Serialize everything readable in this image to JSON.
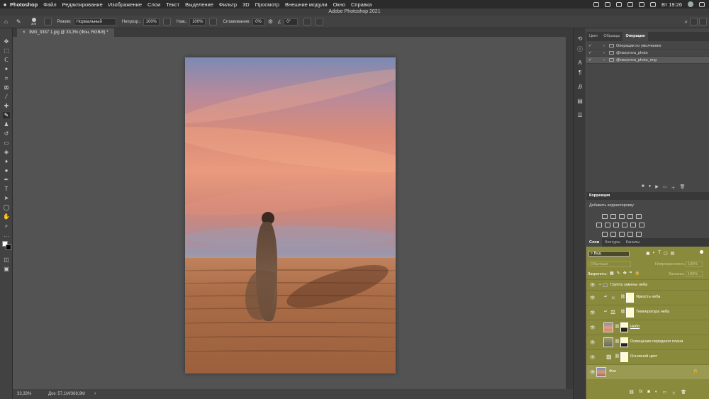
{
  "menubar": {
    "app": "Photoshop",
    "items": [
      "Файл",
      "Редактирование",
      "Изображение",
      "Слои",
      "Текст",
      "Выделение",
      "Фильтр",
      "3D",
      "Просмотр",
      "Внешние модули",
      "Окно",
      "Справка"
    ],
    "clock": "Вт 19:26"
  },
  "titlebar": {
    "title": "Adobe Photoshop 2021"
  },
  "options": {
    "brush_size": "300",
    "mode_label": "Режим:",
    "mode_value": "Нормальный",
    "opacity_label": "Непрозр.:",
    "opacity_value": "100%",
    "pressure_label": "Наж.:",
    "pressure_value": "100%",
    "smoothing_label": "Сглаживание:",
    "smoothing_value": "0%",
    "angle_value": "0°"
  },
  "document": {
    "tab_title": "IMG_3337 1.jpg @ 33,3% (Фон, RGB/8) *",
    "zoom": "33,33%",
    "doc_size": "Док: 57,1М/368,9М"
  },
  "top_panel": {
    "tabs": [
      "Цвет",
      "Образцы",
      "Операции"
    ],
    "active_tab": "Операции",
    "actions": [
      {
        "label": "Операции по умолчанию"
      },
      {
        "label": "@nasyrova_photo"
      },
      {
        "label": "@nasyrova_photo_eng"
      }
    ]
  },
  "adjustments": {
    "title": "Коррекция",
    "subtitle": "Добавить корректировку"
  },
  "layers_panel": {
    "tabs": [
      "Слои",
      "Контуры",
      "Каналы"
    ],
    "active_tab": "Слои",
    "filter_value": "Вид",
    "blend_mode": "Обычные",
    "opacity_label": "Непрозрачность:",
    "opacity_value": "100%",
    "lock_label": "Закрепить:",
    "fill_label": "Заливка:",
    "fill_value": "100%",
    "layers": [
      {
        "name": "Группа замены неба",
        "kind": "group"
      },
      {
        "name": "Яркость неба",
        "kind": "adjustment"
      },
      {
        "name": "Температура неба",
        "kind": "adjustment"
      },
      {
        "name": "Небо",
        "kind": "image"
      },
      {
        "name": "Освещение переднего плана",
        "kind": "image"
      },
      {
        "name": "Основной цвет",
        "kind": "adjustment"
      },
      {
        "name": "Фон",
        "kind": "background"
      }
    ]
  }
}
